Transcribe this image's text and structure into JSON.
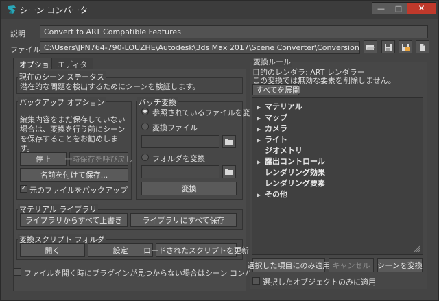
{
  "window": {
    "title": "シーン コンバータ",
    "min_glyph": "—",
    "max_glyph": "□",
    "close_glyph": "✕"
  },
  "header": {
    "description_label": "説明",
    "description_value": "Convert to ART Compatible Features",
    "filename_label": "ファイル名",
    "filename_value": "C:\\Users\\JPN764-790-LOUZHE\\Autodesk\\3ds Max 2017\\Scene Converter\\ConversionPresets\\ART.ms"
  },
  "tabs": [
    {
      "label": "オプション",
      "active": true
    },
    {
      "label": "エディタ",
      "active": false
    }
  ],
  "scene_status": {
    "title": "現在のシーン ステータス",
    "text": "潜在的な問題を検出するためにシーンを検証します。"
  },
  "backup": {
    "title": "バックアップ オプション",
    "description": "編集内容をまだ保存していない場合は、変換を行う前にシーンを保存することをお勧めします。",
    "stop_label": "停止",
    "restore_label": "一時保存を呼び戻し",
    "save_as_label": "名前を付けて保存...",
    "backup_checkbox_label": "元のファイルをバックアップ",
    "backup_checked": true
  },
  "batch": {
    "title": "バッチ変換",
    "opt_referenced": "参照されているファイルを変換",
    "opt_file": "変換ファイル",
    "opt_folder": "フォルダを変換",
    "convert_label": "変換"
  },
  "material_library": {
    "title": "マテリアル ライブラリ",
    "overwrite_label": "ライブラリからすべて上書き",
    "save_all_label": "ライブラリにすべて保存"
  },
  "script_folder": {
    "title": "変換スクリプト フォルダ",
    "open_label": "開く",
    "settings_label": "設定",
    "refresh_label": "ロードされたスクリプトを更新"
  },
  "missing_plugin_label": "ファイルを開く時にプラグインが見つからない場合はシーン コンバータを開く",
  "rules": {
    "title": "変換ルール",
    "target_line": "目的のレンダラ: ART レンダラー",
    "info_line": "この変換では無効な要素を削除しません。",
    "expand_all_label": "すべてを展開",
    "items": [
      {
        "label": "マテリアル",
        "expandable": true
      },
      {
        "label": "マップ",
        "expandable": true
      },
      {
        "label": "カメラ",
        "expandable": true
      },
      {
        "label": "ライト",
        "expandable": true
      },
      {
        "label": "ジオメトリ",
        "expandable": false
      },
      {
        "label": "露出コントロール",
        "expandable": true
      },
      {
        "label": "レンダリング効果",
        "expandable": false
      },
      {
        "label": "レンダリング要素",
        "expandable": false
      },
      {
        "label": "その他",
        "expandable": true
      }
    ],
    "apply_selected_label": "選択した項目にのみ適用",
    "cancel_label": "キャンセル",
    "convert_scene_label": "シーンを変換",
    "selected_objects_label": "選択したオブジェクトのみに適用"
  },
  "arrow_glyph": "▶",
  "check_glyph": "✓",
  "colors": {
    "accent_close": "#c0392b",
    "panel_bg": "#444444",
    "field_bg": "#525252"
  },
  "icons": [
    "app-3ds-icon",
    "folder-open-icon",
    "save-icon",
    "save-as-icon",
    "new-document-icon",
    "folder-icon",
    "resize-grip-icon"
  ]
}
